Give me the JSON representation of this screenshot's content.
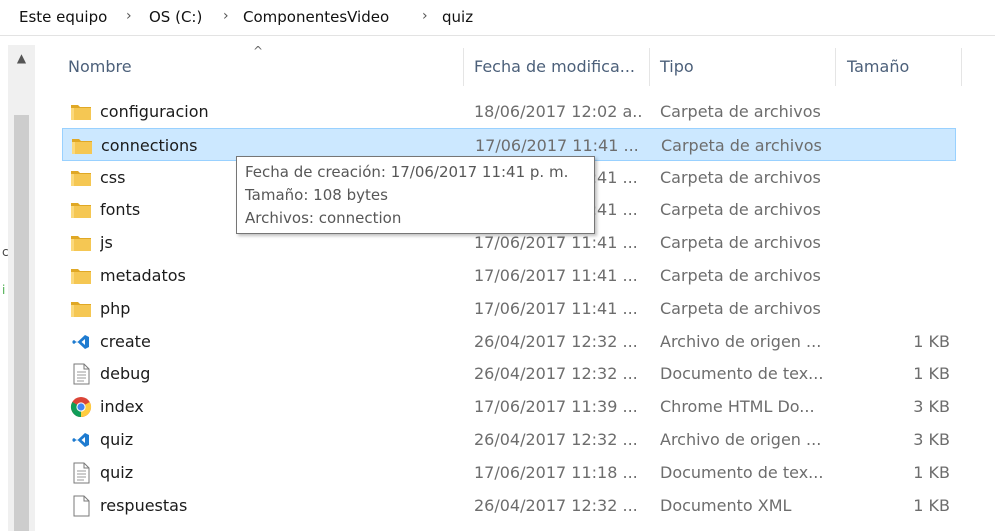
{
  "breadcrumb": {
    "items": [
      "Este equipo",
      "OS (C:)",
      "ComponentesVideo",
      "quiz"
    ],
    "separator": "›"
  },
  "columns": {
    "name": "Nombre",
    "date": "Fecha de modifica...",
    "type": "Tipo",
    "size": "Tamaño"
  },
  "sort_indicator": "^",
  "scroll_up_glyph": "▲",
  "left_marks": [
    "c",
    "i"
  ],
  "colors": {
    "selection_bg": "#cce8ff",
    "selection_border": "#99d1ff",
    "folder": "#f5c753",
    "header_text": "#4c607a"
  },
  "files": [
    {
      "name": "configuracion",
      "date": "18/06/2017 12:02 a...",
      "type": "Carpeta de archivos",
      "size": "",
      "icon": "folder-icon"
    },
    {
      "name": "connections",
      "date": "17/06/2017 11:41 ...",
      "type": "Carpeta de archivos",
      "size": "",
      "icon": "folder-icon",
      "selected": true
    },
    {
      "name": "css",
      "date": "17/06/2017 11:41 ...",
      "type": "Carpeta de archivos",
      "size": "",
      "icon": "folder-icon"
    },
    {
      "name": "fonts",
      "date": "17/06/2017 11:41 ...",
      "type": "Carpeta de archivos",
      "size": "",
      "icon": "folder-icon"
    },
    {
      "name": "js",
      "date": "17/06/2017 11:41 ...",
      "type": "Carpeta de archivos",
      "size": "",
      "icon": "folder-icon"
    },
    {
      "name": "metadatos",
      "date": "17/06/2017 11:41 ...",
      "type": "Carpeta de archivos",
      "size": "",
      "icon": "folder-icon"
    },
    {
      "name": "php",
      "date": "17/06/2017 11:41 ...",
      "type": "Carpeta de archivos",
      "size": "",
      "icon": "folder-icon"
    },
    {
      "name": "create",
      "date": "26/04/2017 12:32 ...",
      "type": "Archivo de origen ...",
      "size": "1 KB",
      "icon": "vscode-file-icon"
    },
    {
      "name": "debug",
      "date": "26/04/2017 12:32 ...",
      "type": "Documento de tex...",
      "size": "1 KB",
      "icon": "text-document-icon"
    },
    {
      "name": "index",
      "date": "17/06/2017 11:39 ...",
      "type": "Chrome HTML Do...",
      "size": "3 KB",
      "icon": "chrome-icon"
    },
    {
      "name": "quiz",
      "date": "26/04/2017 12:32 ...",
      "type": "Archivo de origen ...",
      "size": "3 KB",
      "icon": "vscode-file-icon"
    },
    {
      "name": "quiz",
      "date": "17/06/2017 11:18 ...",
      "type": "Documento de tex...",
      "size": "1 KB",
      "icon": "text-document-icon"
    },
    {
      "name": "respuestas",
      "date": "26/04/2017 12:32 ...",
      "type": "Documento XML",
      "size": "1 KB",
      "icon": "blank-document-icon"
    }
  ],
  "tooltip": {
    "lines": [
      "Fecha de creación: 17/06/2017 11:41 p. m.",
      "Tamaño: 108 bytes",
      "Archivos: connection"
    ]
  }
}
